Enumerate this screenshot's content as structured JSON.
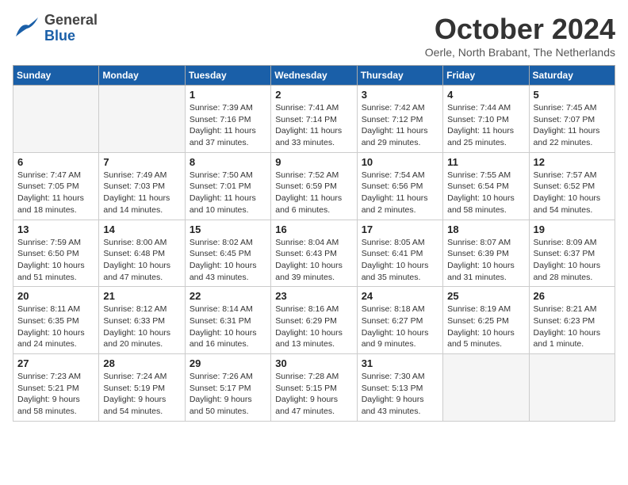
{
  "header": {
    "logo_line1": "General",
    "logo_line2": "Blue",
    "month": "October 2024",
    "location": "Oerle, North Brabant, The Netherlands"
  },
  "weekdays": [
    "Sunday",
    "Monday",
    "Tuesday",
    "Wednesday",
    "Thursday",
    "Friday",
    "Saturday"
  ],
  "weeks": [
    [
      {
        "day": "",
        "sunrise": "",
        "sunset": "",
        "daylight": ""
      },
      {
        "day": "",
        "sunrise": "",
        "sunset": "",
        "daylight": ""
      },
      {
        "day": "1",
        "sunrise": "Sunrise: 7:39 AM",
        "sunset": "Sunset: 7:16 PM",
        "daylight": "Daylight: 11 hours and 37 minutes."
      },
      {
        "day": "2",
        "sunrise": "Sunrise: 7:41 AM",
        "sunset": "Sunset: 7:14 PM",
        "daylight": "Daylight: 11 hours and 33 minutes."
      },
      {
        "day": "3",
        "sunrise": "Sunrise: 7:42 AM",
        "sunset": "Sunset: 7:12 PM",
        "daylight": "Daylight: 11 hours and 29 minutes."
      },
      {
        "day": "4",
        "sunrise": "Sunrise: 7:44 AM",
        "sunset": "Sunset: 7:10 PM",
        "daylight": "Daylight: 11 hours and 25 minutes."
      },
      {
        "day": "5",
        "sunrise": "Sunrise: 7:45 AM",
        "sunset": "Sunset: 7:07 PM",
        "daylight": "Daylight: 11 hours and 22 minutes."
      }
    ],
    [
      {
        "day": "6",
        "sunrise": "Sunrise: 7:47 AM",
        "sunset": "Sunset: 7:05 PM",
        "daylight": "Daylight: 11 hours and 18 minutes."
      },
      {
        "day": "7",
        "sunrise": "Sunrise: 7:49 AM",
        "sunset": "Sunset: 7:03 PM",
        "daylight": "Daylight: 11 hours and 14 minutes."
      },
      {
        "day": "8",
        "sunrise": "Sunrise: 7:50 AM",
        "sunset": "Sunset: 7:01 PM",
        "daylight": "Daylight: 11 hours and 10 minutes."
      },
      {
        "day": "9",
        "sunrise": "Sunrise: 7:52 AM",
        "sunset": "Sunset: 6:59 PM",
        "daylight": "Daylight: 11 hours and 6 minutes."
      },
      {
        "day": "10",
        "sunrise": "Sunrise: 7:54 AM",
        "sunset": "Sunset: 6:56 PM",
        "daylight": "Daylight: 11 hours and 2 minutes."
      },
      {
        "day": "11",
        "sunrise": "Sunrise: 7:55 AM",
        "sunset": "Sunset: 6:54 PM",
        "daylight": "Daylight: 10 hours and 58 minutes."
      },
      {
        "day": "12",
        "sunrise": "Sunrise: 7:57 AM",
        "sunset": "Sunset: 6:52 PM",
        "daylight": "Daylight: 10 hours and 54 minutes."
      }
    ],
    [
      {
        "day": "13",
        "sunrise": "Sunrise: 7:59 AM",
        "sunset": "Sunset: 6:50 PM",
        "daylight": "Daylight: 10 hours and 51 minutes."
      },
      {
        "day": "14",
        "sunrise": "Sunrise: 8:00 AM",
        "sunset": "Sunset: 6:48 PM",
        "daylight": "Daylight: 10 hours and 47 minutes."
      },
      {
        "day": "15",
        "sunrise": "Sunrise: 8:02 AM",
        "sunset": "Sunset: 6:45 PM",
        "daylight": "Daylight: 10 hours and 43 minutes."
      },
      {
        "day": "16",
        "sunrise": "Sunrise: 8:04 AM",
        "sunset": "Sunset: 6:43 PM",
        "daylight": "Daylight: 10 hours and 39 minutes."
      },
      {
        "day": "17",
        "sunrise": "Sunrise: 8:05 AM",
        "sunset": "Sunset: 6:41 PM",
        "daylight": "Daylight: 10 hours and 35 minutes."
      },
      {
        "day": "18",
        "sunrise": "Sunrise: 8:07 AM",
        "sunset": "Sunset: 6:39 PM",
        "daylight": "Daylight: 10 hours and 31 minutes."
      },
      {
        "day": "19",
        "sunrise": "Sunrise: 8:09 AM",
        "sunset": "Sunset: 6:37 PM",
        "daylight": "Daylight: 10 hours and 28 minutes."
      }
    ],
    [
      {
        "day": "20",
        "sunrise": "Sunrise: 8:11 AM",
        "sunset": "Sunset: 6:35 PM",
        "daylight": "Daylight: 10 hours and 24 minutes."
      },
      {
        "day": "21",
        "sunrise": "Sunrise: 8:12 AM",
        "sunset": "Sunset: 6:33 PM",
        "daylight": "Daylight: 10 hours and 20 minutes."
      },
      {
        "day": "22",
        "sunrise": "Sunrise: 8:14 AM",
        "sunset": "Sunset: 6:31 PM",
        "daylight": "Daylight: 10 hours and 16 minutes."
      },
      {
        "day": "23",
        "sunrise": "Sunrise: 8:16 AM",
        "sunset": "Sunset: 6:29 PM",
        "daylight": "Daylight: 10 hours and 13 minutes."
      },
      {
        "day": "24",
        "sunrise": "Sunrise: 8:18 AM",
        "sunset": "Sunset: 6:27 PM",
        "daylight": "Daylight: 10 hours and 9 minutes."
      },
      {
        "day": "25",
        "sunrise": "Sunrise: 8:19 AM",
        "sunset": "Sunset: 6:25 PM",
        "daylight": "Daylight: 10 hours and 5 minutes."
      },
      {
        "day": "26",
        "sunrise": "Sunrise: 8:21 AM",
        "sunset": "Sunset: 6:23 PM",
        "daylight": "Daylight: 10 hours and 1 minute."
      }
    ],
    [
      {
        "day": "27",
        "sunrise": "Sunrise: 7:23 AM",
        "sunset": "Sunset: 5:21 PM",
        "daylight": "Daylight: 9 hours and 58 minutes."
      },
      {
        "day": "28",
        "sunrise": "Sunrise: 7:24 AM",
        "sunset": "Sunset: 5:19 PM",
        "daylight": "Daylight: 9 hours and 54 minutes."
      },
      {
        "day": "29",
        "sunrise": "Sunrise: 7:26 AM",
        "sunset": "Sunset: 5:17 PM",
        "daylight": "Daylight: 9 hours and 50 minutes."
      },
      {
        "day": "30",
        "sunrise": "Sunrise: 7:28 AM",
        "sunset": "Sunset: 5:15 PM",
        "daylight": "Daylight: 9 hours and 47 minutes."
      },
      {
        "day": "31",
        "sunrise": "Sunrise: 7:30 AM",
        "sunset": "Sunset: 5:13 PM",
        "daylight": "Daylight: 9 hours and 43 minutes."
      },
      {
        "day": "",
        "sunrise": "",
        "sunset": "",
        "daylight": ""
      },
      {
        "day": "",
        "sunrise": "",
        "sunset": "",
        "daylight": ""
      }
    ]
  ]
}
